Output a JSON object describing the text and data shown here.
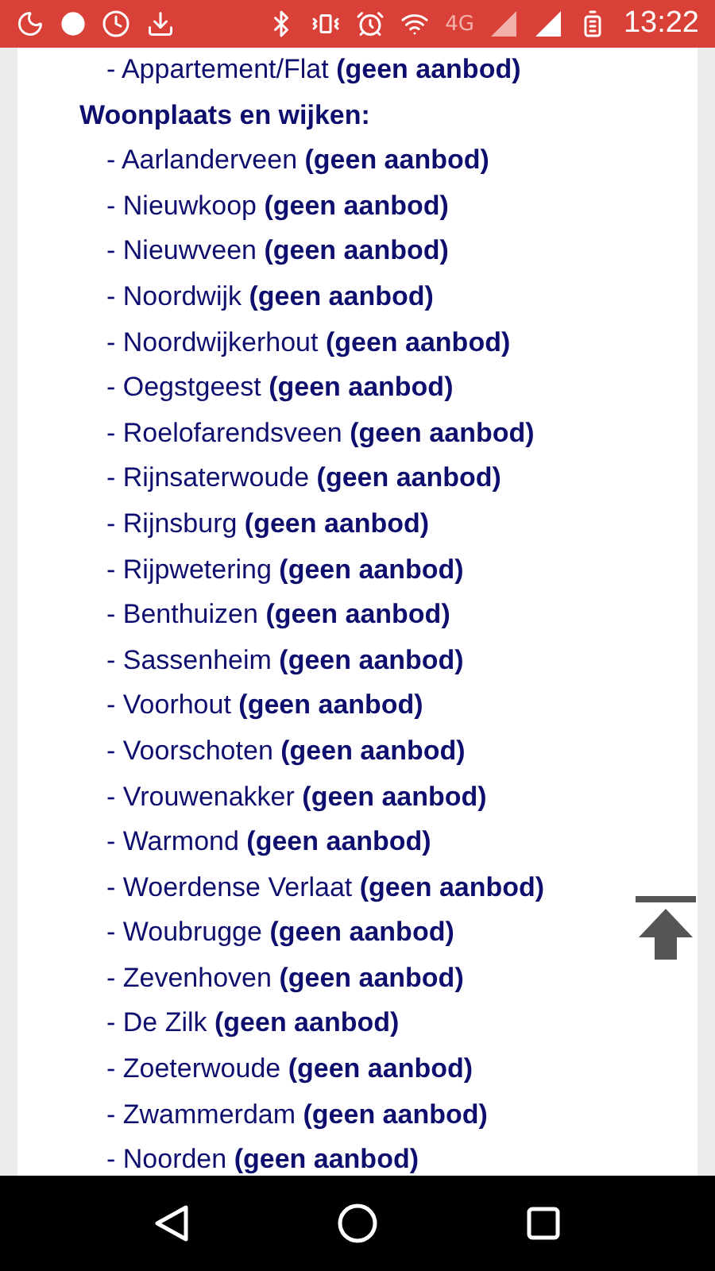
{
  "status_bar": {
    "network": "4G",
    "time": "13:22"
  },
  "content": {
    "lines": [
      {
        "kind": "item",
        "text": "- Appartement/Flat **(geen aanbod)**"
      },
      {
        "kind": "heading",
        "text": "Woonplaats en wijken:"
      },
      {
        "kind": "item",
        "text": "- Aarlanderveen **(geen aanbod)**"
      },
      {
        "kind": "item",
        "text": "- Nieuwkoop **(geen aanbod)**"
      },
      {
        "kind": "item",
        "text": "- Nieuwveen **(geen aanbod)**"
      },
      {
        "kind": "item",
        "text": "- Noordwijk **(geen aanbod)**"
      },
      {
        "kind": "item",
        "text": "- Noordwijkerhout **(geen aanbod)**"
      },
      {
        "kind": "item",
        "text": "- Oegstgeest **(geen aanbod)**"
      },
      {
        "kind": "item",
        "text": "- Roelofarendsveen **(geen aanbod)**"
      },
      {
        "kind": "item",
        "text": "- Rijnsaterwoude **(geen aanbod)**"
      },
      {
        "kind": "item",
        "text": "- Rijnsburg **(geen aanbod)**"
      },
      {
        "kind": "item",
        "text": "- Rijpwetering **(geen aanbod)**"
      },
      {
        "kind": "item",
        "text": "- Benthuizen **(geen aanbod)**"
      },
      {
        "kind": "item",
        "text": "- Sassenheim **(geen aanbod)**"
      },
      {
        "kind": "item",
        "text": "- Voorhout **(geen aanbod)**"
      },
      {
        "kind": "item",
        "text": "- Voorschoten **(geen aanbod)**"
      },
      {
        "kind": "item",
        "text": "- Vrouwenakker **(geen aanbod)**"
      },
      {
        "kind": "item",
        "text": "- Warmond **(geen aanbod)**"
      },
      {
        "kind": "item",
        "text": "- Woerdense Verlaat **(geen aanbod)**"
      },
      {
        "kind": "item",
        "text": "- Woubrugge **(geen aanbod)**"
      },
      {
        "kind": "item",
        "text": "- Zevenhoven **(geen aanbod)**"
      },
      {
        "kind": "item",
        "text": "- De Zilk **(geen aanbod)**"
      },
      {
        "kind": "item",
        "text": "- Zoeterwoude **(geen aanbod)**"
      },
      {
        "kind": "item",
        "text": "- Zwammerdam **(geen aanbod)**"
      },
      {
        "kind": "item",
        "text": "- Noorden **(geen aanbod)**"
      }
    ]
  }
}
